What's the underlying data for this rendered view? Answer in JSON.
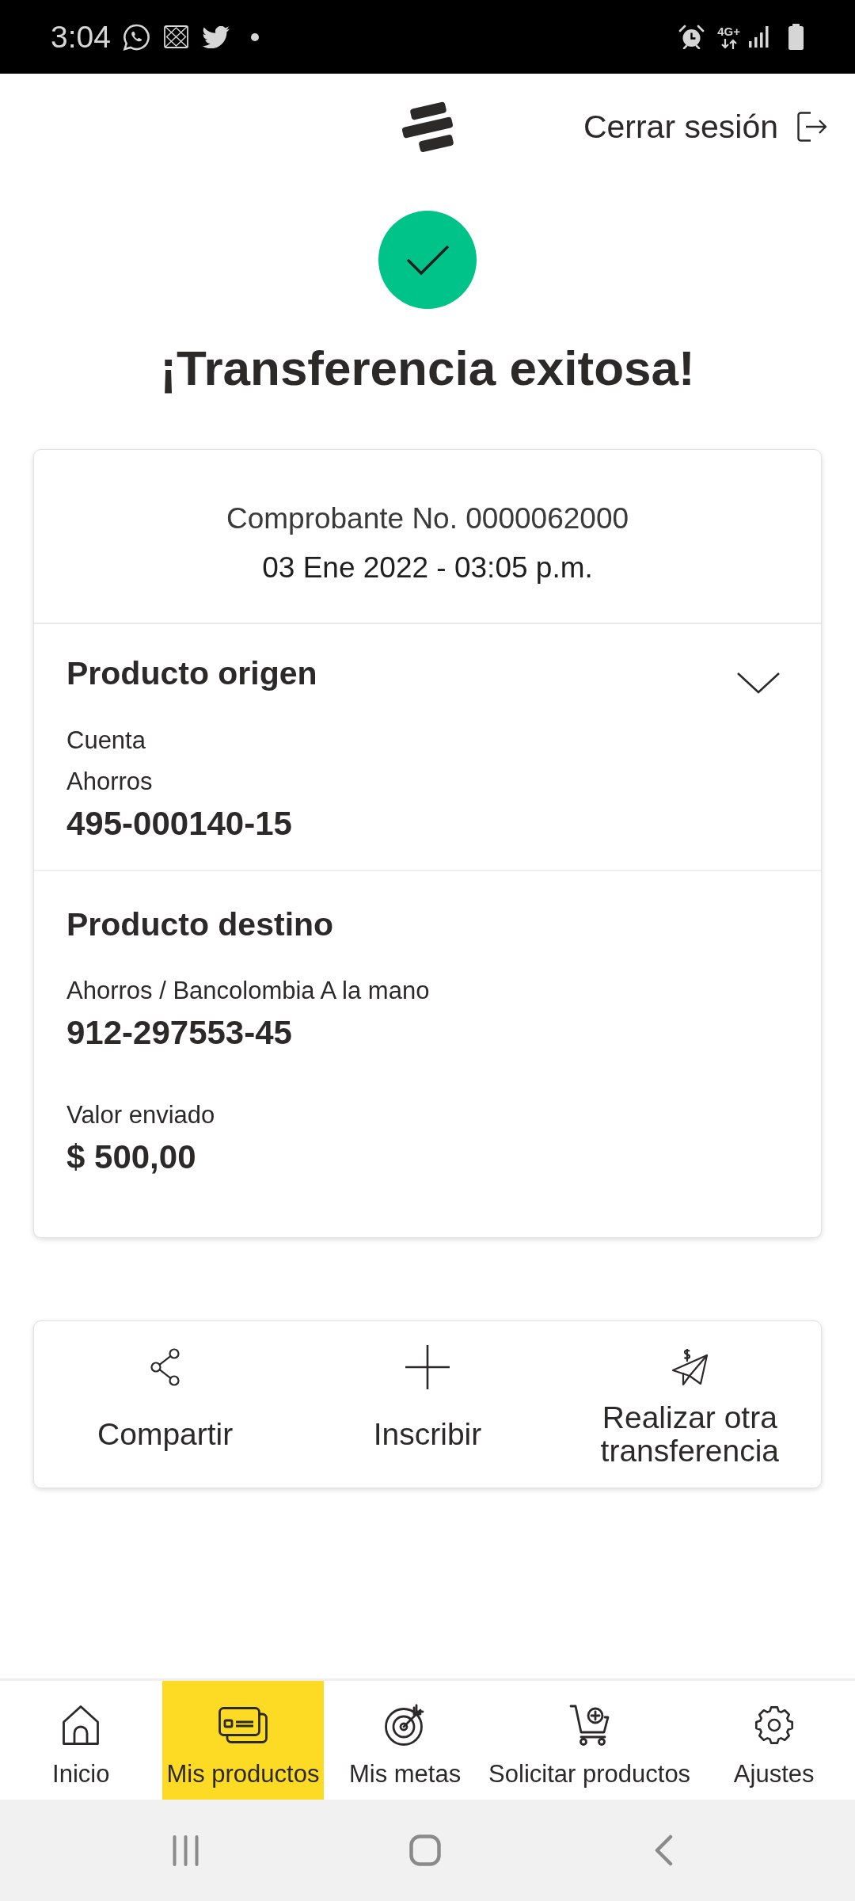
{
  "status_bar": {
    "time": "3:04",
    "network": "4G+"
  },
  "header": {
    "logout": "Cerrar sesión"
  },
  "result": {
    "title": "¡Transferencia exitosa!"
  },
  "receipt": {
    "number": "Comprobante No. 0000062000",
    "date": "03 Ene 2022 - 03:05 p.m.",
    "sections": [
      {
        "title": "Producto origen",
        "collapsible": true,
        "groups": [
          {
            "lines": [
              {
                "kind": "label",
                "text": "Cuenta"
              },
              {
                "kind": "label",
                "text": "Ahorros"
              },
              {
                "kind": "value",
                "text": "495-000140-15"
              }
            ]
          }
        ]
      },
      {
        "title": "Producto destino",
        "collapsible": false,
        "groups": [
          {
            "lines": [
              {
                "kind": "label",
                "text": "Ahorros / Bancolombia A la mano"
              },
              {
                "kind": "value",
                "text": "912-297553-45"
              }
            ]
          },
          {
            "lines": [
              {
                "kind": "label",
                "text": "Valor enviado"
              },
              {
                "kind": "value",
                "text": "$ 500,00"
              }
            ]
          }
        ]
      }
    ]
  },
  "actions": [
    {
      "label": "Compartir"
    },
    {
      "label": "Inscribir"
    },
    {
      "label": "Realizar otra transferencia"
    }
  ],
  "bottom_nav": [
    {
      "label": "Inicio",
      "selected": false
    },
    {
      "label": "Mis productos",
      "selected": true
    },
    {
      "label": "Mis metas",
      "selected": false
    },
    {
      "label": "Solicitar productos",
      "selected": false
    },
    {
      "label": "Ajustes",
      "selected": false
    }
  ]
}
